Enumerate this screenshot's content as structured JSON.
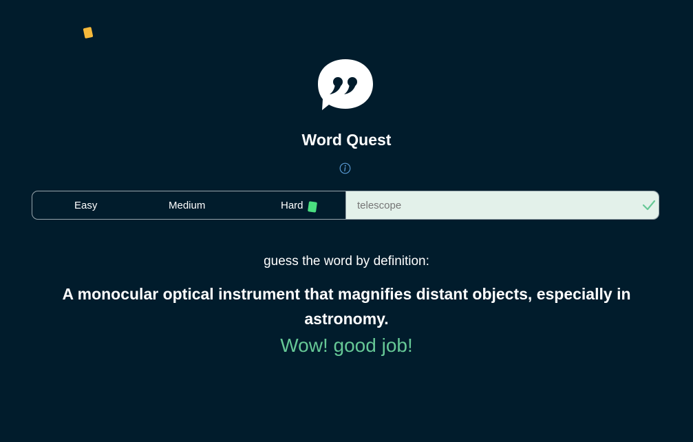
{
  "app": {
    "title": "Word Quest"
  },
  "levels": [
    {
      "label": "Easy"
    },
    {
      "label": "Medium"
    },
    {
      "label": "Hard"
    }
  ],
  "answer": {
    "value": "",
    "placeholder": "telescope"
  },
  "game": {
    "prompt": "guess the word by definition:",
    "definition": "A monocular optical instrument that magnifies distant objects, especially in astronomy.",
    "feedback": "Wow! good job!"
  },
  "icons": {
    "logo": "quote-bubble-icon",
    "info": "info-icon",
    "check": "check-icon"
  },
  "colors": {
    "background": "#011c2c",
    "success": "#66c896",
    "input_bg": "#e3f1ea",
    "info": "#5b9bd5",
    "confetti_yellow": "#f6b93b",
    "confetti_green": "#4ade80"
  }
}
